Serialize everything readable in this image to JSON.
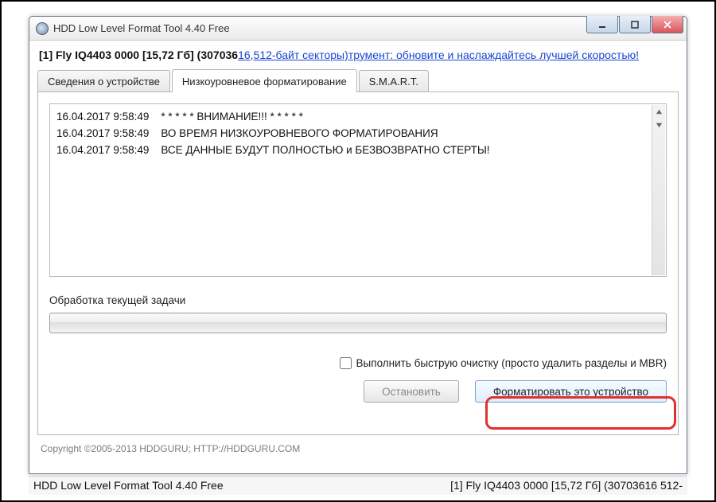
{
  "window": {
    "title": "HDD Low Level Format Tool 4.40   Free",
    "controls": {
      "min": "minimize",
      "max": "maximize",
      "close": "close"
    }
  },
  "info": {
    "device_prefix": "[1]  Fly IQ4403   0000   [15,72 Гб]   (307036",
    "overlap": "16,512-байт секторы)",
    "link_text": "трумент: обновите и наслаждайтесь лучшей скоростью!"
  },
  "tabs": {
    "device_info": "Сведения о устройстве",
    "low_level": "Низкоуровневое форматирование",
    "smart": "S.M.A.R.T."
  },
  "log": {
    "lines": [
      "16.04.2017 9:58:49    * * * * * ВНИМАНИЕ!!! * * * * *",
      "16.04.2017 9:58:49    ВО ВРЕМЯ НИЗКОУРОВНЕВОГО ФОРМАТИРОВАНИЯ",
      "16.04.2017 9:58:49    ВСЕ ДАННЫЕ БУДУТ ПОЛНОСТЬЮ и БЕЗВОЗВРАТНО СТЕРТЫ!"
    ]
  },
  "task": {
    "label": "Обработка текущей задачи"
  },
  "quick_wipe": {
    "label": "Выполнить быструю очистку (просто удалить разделы и MBR)"
  },
  "buttons": {
    "stop": "Остановить",
    "format": "Форматировать это устройство"
  },
  "footer": {
    "copyright": "Copyright ©2005-2013 HDDGURU;   HTTP://HDDGURU.COM"
  },
  "statusbar": {
    "left": "HDD Low Level Format Tool 4.40    Free",
    "right": "[1]  Fly IQ4403   0000   [15,72 Гб]   (30703616 512-"
  }
}
